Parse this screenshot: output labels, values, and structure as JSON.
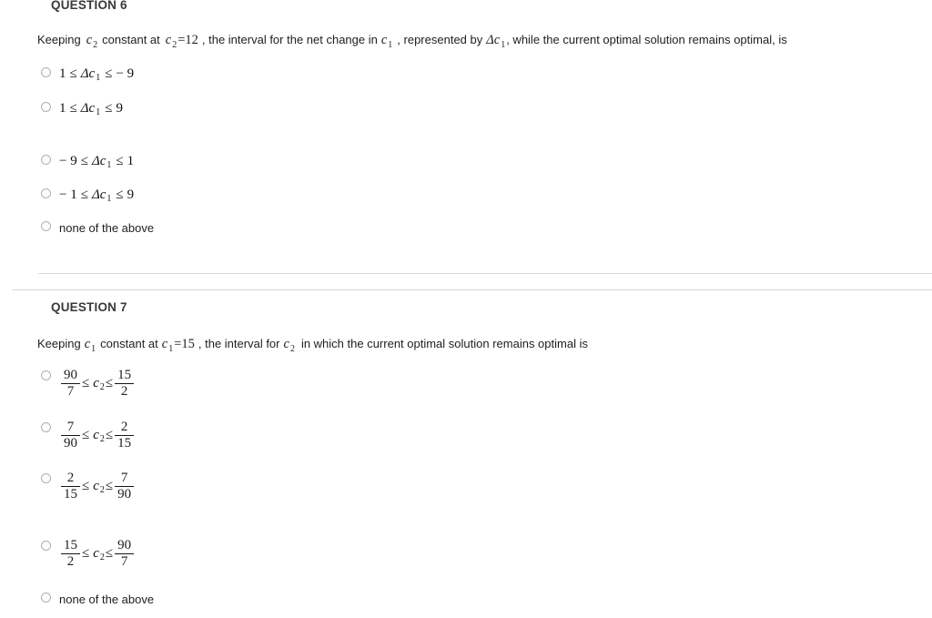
{
  "page": {
    "background": "#ffffff",
    "text_color": "#1e1e1e",
    "heading_color": "#3a3a3a",
    "divider_color": "#d7d7d7",
    "radio_border_color": "#b0b0b0"
  },
  "questions": [
    {
      "heading": "QUESTION 6",
      "prompt": {
        "part1": "Keeping",
        "var1": "c",
        "var1_sub": "2",
        "part2": "constant at",
        "var2": "c",
        "var2_sub": "2",
        "equals": "=",
        "value": "12",
        "part3": ", the interval for the net change in",
        "var3": "c",
        "var3_sub": "1",
        "part4": ", represented by",
        "delta": "Δc",
        "delta_sub": "1",
        "part5": ", while the current optimal solution remains optimal, is",
        "full_text": "Keeping c₂ constant at c₂ = 12 , the interval for the net change in c₁ , represented by Δc₁, while the current optimal solution remains optimal, is"
      },
      "options": [
        {
          "id": "q6-opt-1",
          "kind": "inequality",
          "left": "1",
          "rel1": "≤",
          "var": "Δc",
          "var_sub": "1",
          "rel2": "≤",
          "right": "− 9",
          "text": "1 ≤ Δc₁ ≤ − 9",
          "extra_gap_before": false
        },
        {
          "id": "q6-opt-2",
          "kind": "inequality",
          "left": "1",
          "rel1": "≤",
          "var": "Δc",
          "var_sub": "1",
          "rel2": "≤",
          "right": "9",
          "text": "1 ≤ Δc₁ ≤ 9",
          "extra_gap_before": false
        },
        {
          "id": "q6-opt-3",
          "kind": "inequality",
          "left": "− 9",
          "rel1": "≤",
          "var": "Δc",
          "var_sub": "1",
          "rel2": "≤",
          "right": "1",
          "text": "− 9 ≤ Δc₁ ≤ 1",
          "extra_gap_before": true
        },
        {
          "id": "q6-opt-4",
          "kind": "inequality",
          "left": "− 1",
          "rel1": "≤",
          "var": "Δc",
          "var_sub": "1",
          "rel2": "≤",
          "right": "9",
          "text": "− 1 ≤ Δc₁ ≤ 9",
          "extra_gap_before": false
        },
        {
          "id": "q6-opt-5",
          "kind": "plain",
          "text": "none of the above",
          "extra_gap_before": false
        }
      ]
    },
    {
      "heading": "QUESTION 7",
      "prompt": {
        "part1": "Keeping",
        "var1": "c",
        "var1_sub": "1",
        "part2": "constant at",
        "var2": "c",
        "var2_sub": "1",
        "equals": "=",
        "value": "15",
        "part3": ", the interval for",
        "var3": "c",
        "var3_sub": "2",
        "part4": "in which the current optimal solution remains optimal is",
        "full_text": "Keeping c₁ constant at c₁ = 15 , the interval for c₂ in which the current optimal solution remains optimal is"
      },
      "options": [
        {
          "id": "q7-opt-1",
          "kind": "fraction",
          "left_num": "90",
          "left_den": "7",
          "rel1": "≤",
          "var": "c",
          "var_sub": "2",
          "rel2": "≤",
          "right_num": "15",
          "right_den": "2",
          "text": "90/7 ≤ c₂ ≤ 15/2",
          "extra_gap_before": false
        },
        {
          "id": "q7-opt-2",
          "kind": "fraction",
          "left_num": "7",
          "left_den": "90",
          "rel1": "≤",
          "var": "c",
          "var_sub": "2",
          "rel2": "≤",
          "right_num": "2",
          "right_den": "15",
          "text": "7/90 ≤ c₂ ≤ 2/15",
          "extra_gap_before": false
        },
        {
          "id": "q7-opt-3",
          "kind": "fraction",
          "left_num": "2",
          "left_den": "15",
          "rel1": "≤",
          "var": "c",
          "var_sub": "2",
          "rel2": "≤",
          "right_num": "7",
          "right_den": "90",
          "text": "2/15 ≤ c₂ ≤ 7/90",
          "extra_gap_before": false
        },
        {
          "id": "q7-opt-4",
          "kind": "fraction",
          "left_num": "15",
          "left_den": "2",
          "rel1": "≤",
          "var": "c",
          "var_sub": "2",
          "rel2": "≤",
          "right_num": "90",
          "right_den": "7",
          "text": "15/2 ≤ c₂ ≤ 90/7",
          "extra_gap_before": true
        },
        {
          "id": "q7-opt-5",
          "kind": "plain",
          "text": "none of the above",
          "extra_gap_before": false
        }
      ]
    }
  ]
}
